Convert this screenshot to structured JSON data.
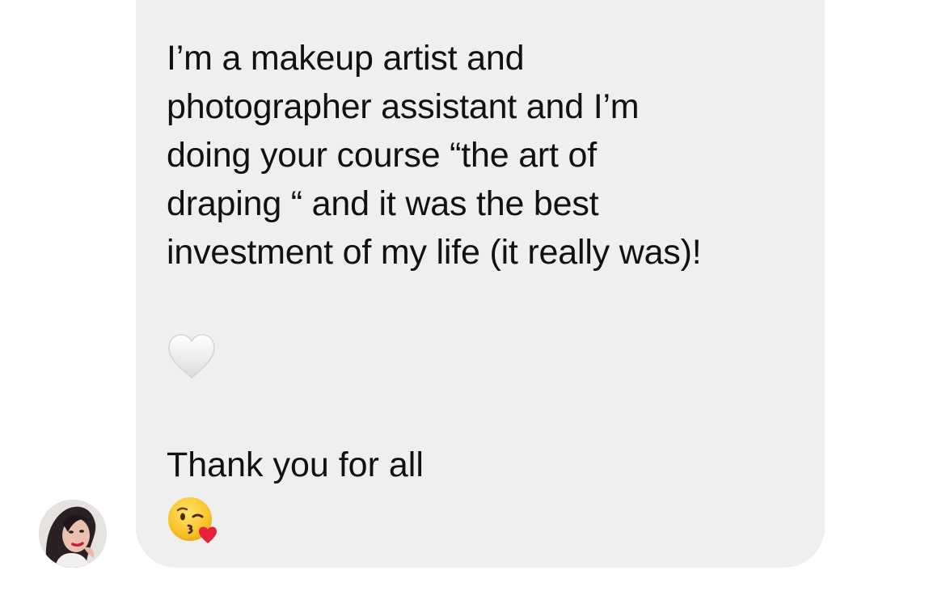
{
  "message": {
    "lines": [
      "I’m a makeup artist and",
      "photographer assistant and I’m",
      "doing your course “the art of",
      "draping “ and it was the best",
      "investment of my life (it really was)!"
    ],
    "reaction_emoji": "white-heart-emoji",
    "closing_text": "Thank you for all",
    "closing_emoji": "face-blowing-kiss-emoji",
    "bubble_color": "#efefef",
    "text_color": "#111111"
  },
  "sender": {
    "avatar": "user-avatar-photo"
  }
}
